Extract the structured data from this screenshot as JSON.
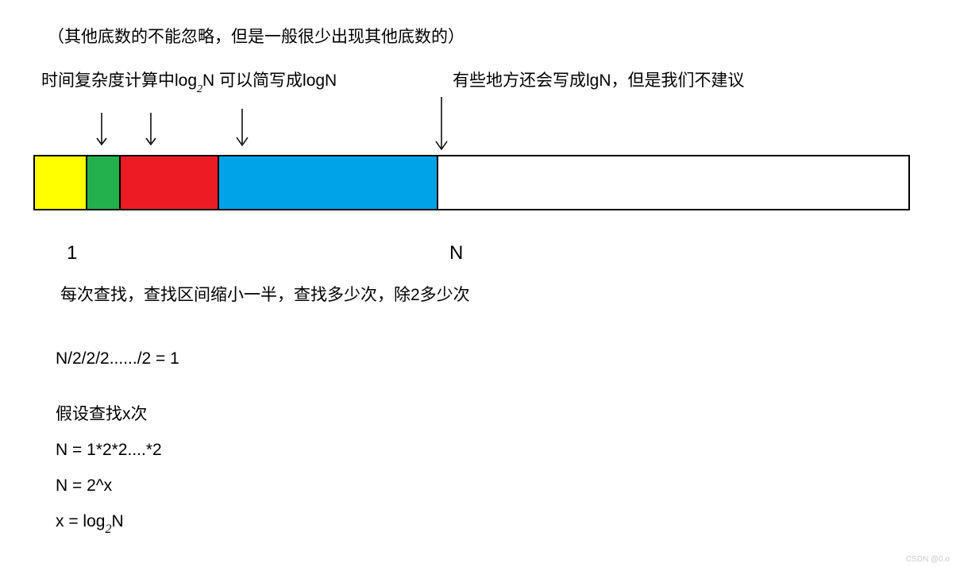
{
  "line1": "（其他底数的不能忽略，但是一般很少出现其他底数的）",
  "line2a": "时间复杂度计算中log",
  "line2_sub": "2",
  "line2b": "N  可以简写成logN",
  "line2c": "有些地方还会写成lgN，但是我们不建议",
  "label_1": "1",
  "label_N": "N",
  "explanation": "每次查找，查找区间缩小一半，查找多少次，除2多少次",
  "eq1": "N/2/2/2....../2  =   1",
  "assume": "假设查找x次",
  "eq2": "N = 1*2*2....*2",
  "eq3": "N = 2^x",
  "eq4a": "x = log",
  "eq4_sub": "2",
  "eq4b": "N",
  "watermark": "CSDN @0.o",
  "colors": {
    "yellow": "#ffff00",
    "green": "#22b14c",
    "red": "#ed1c24",
    "blue": "#00a2e8",
    "white": "#ffffff"
  }
}
